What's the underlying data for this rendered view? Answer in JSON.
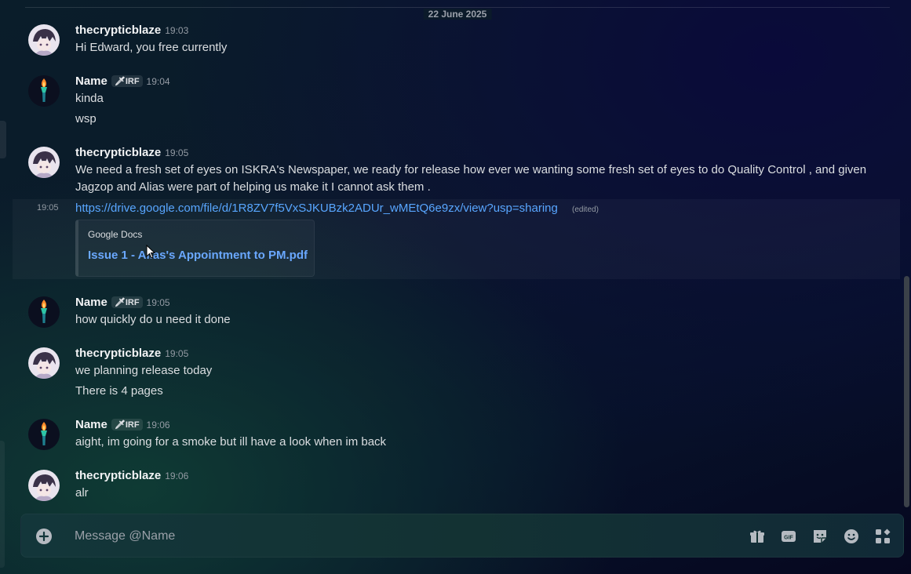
{
  "divider": {
    "date": "22 June 2025"
  },
  "messages": [
    {
      "author": "thecrypticblaze",
      "time": "19:03",
      "lines": [
        "Hi Edward, you free currently"
      ]
    },
    {
      "author": "Name",
      "tag": "🗡IRF",
      "time": "19:04",
      "lines": [
        "kinda",
        "wsp"
      ]
    },
    {
      "author": "thecrypticblaze",
      "time": "19:05",
      "lines": [
        "We need a fresh set of eyes on ISKRA's Newspaper, we ready for release how ever we wanting some fresh set of eyes to do Quality Control , and given",
        "Jagzop and Alias were part of helping us make it I cannot ask them ."
      ]
    },
    {
      "author": "Name",
      "tag": "🗡IRF",
      "time": "19:05",
      "lines": [
        "how quickly do u need it done"
      ]
    },
    {
      "author": "thecrypticblaze",
      "time": "19:05",
      "lines": [
        "we planning release today",
        "There is 4 pages"
      ]
    },
    {
      "author": "Name",
      "tag": "🗡IRF",
      "time": "19:06",
      "lines": [
        "aight, im going for a smoke but ill have a look when im back"
      ]
    },
    {
      "author": "thecrypticblaze",
      "time": "19:06",
      "lines": [
        "alr"
      ]
    }
  ],
  "followup": {
    "time": "19:05",
    "link": "https://drive.google.com/file/d/1R8ZV7f5VxSJKUBzk2ADUr_wMEtQ6e9zx/view?usp=sharing",
    "edited": "(edited)",
    "embed": {
      "provider": "Google Docs",
      "title": "Issue 1 - Alias's Appointment to PM.pdf"
    }
  },
  "composer": {
    "placeholder": "Message @Name"
  },
  "icons": {
    "add": "plus-circle-icon",
    "gift": "gift-icon",
    "gif": "gif-icon",
    "sticker": "sticker-icon",
    "emoji": "emoji-icon",
    "apps": "apps-icon"
  },
  "colors": {
    "link": "#58a6ff",
    "accent": "#6aa8ff"
  }
}
